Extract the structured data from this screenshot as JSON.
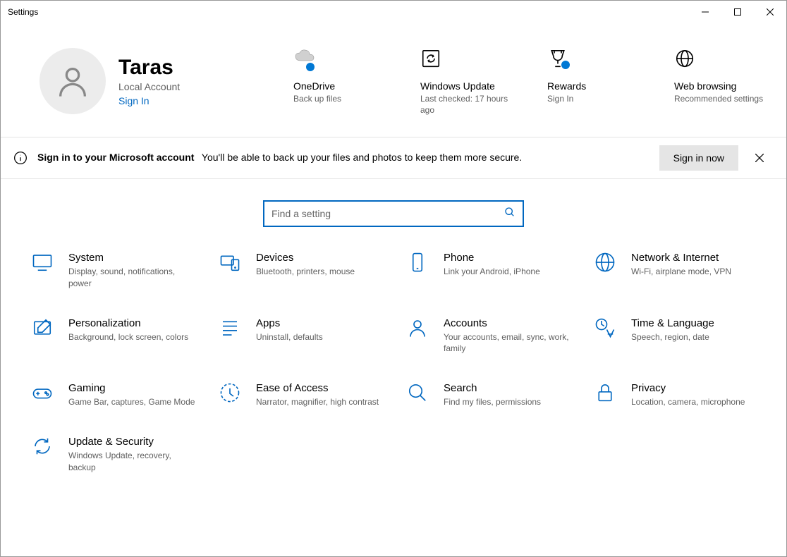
{
  "window_title": "Settings",
  "user": {
    "name": "Taras",
    "account_type": "Local Account",
    "signin_label": "Sign In"
  },
  "status_cards": [
    {
      "title": "OneDrive",
      "desc": "Back up files",
      "icon": "onedrive",
      "badge": true
    },
    {
      "title": "Windows Update",
      "desc": "Last checked: 17 hours ago",
      "icon": "update",
      "badge": false
    },
    {
      "title": "Rewards",
      "desc": "Sign In",
      "icon": "rewards",
      "badge": true
    },
    {
      "title": "Web browsing",
      "desc": "Recommended settings",
      "icon": "globe",
      "badge": false
    }
  ],
  "banner": {
    "title": "Sign in to your Microsoft account",
    "desc": "You'll be able to back up your files and photos to keep them more secure.",
    "button": "Sign in now"
  },
  "search": {
    "placeholder": "Find a setting"
  },
  "categories": [
    {
      "title": "System",
      "desc": "Display, sound, notifications, power",
      "icon": "system"
    },
    {
      "title": "Devices",
      "desc": "Bluetooth, printers, mouse",
      "icon": "devices"
    },
    {
      "title": "Phone",
      "desc": "Link your Android, iPhone",
      "icon": "phone"
    },
    {
      "title": "Network & Internet",
      "desc": "Wi-Fi, airplane mode, VPN",
      "icon": "network"
    },
    {
      "title": "Personalization",
      "desc": "Background, lock screen, colors",
      "icon": "personalization"
    },
    {
      "title": "Apps",
      "desc": "Uninstall, defaults",
      "icon": "apps"
    },
    {
      "title": "Accounts",
      "desc": "Your accounts, email, sync, work, family",
      "icon": "accounts"
    },
    {
      "title": "Time & Language",
      "desc": "Speech, region, date",
      "icon": "time"
    },
    {
      "title": "Gaming",
      "desc": "Game Bar, captures, Game Mode",
      "icon": "gaming"
    },
    {
      "title": "Ease of Access",
      "desc": "Narrator, magnifier, high contrast",
      "icon": "ease"
    },
    {
      "title": "Search",
      "desc": "Find my files, permissions",
      "icon": "search"
    },
    {
      "title": "Privacy",
      "desc": "Location, camera, microphone",
      "icon": "privacy"
    },
    {
      "title": "Update & Security",
      "desc": "Windows Update, recovery, backup",
      "icon": "updatesec"
    }
  ],
  "colors": {
    "accent": "#0067c0"
  }
}
